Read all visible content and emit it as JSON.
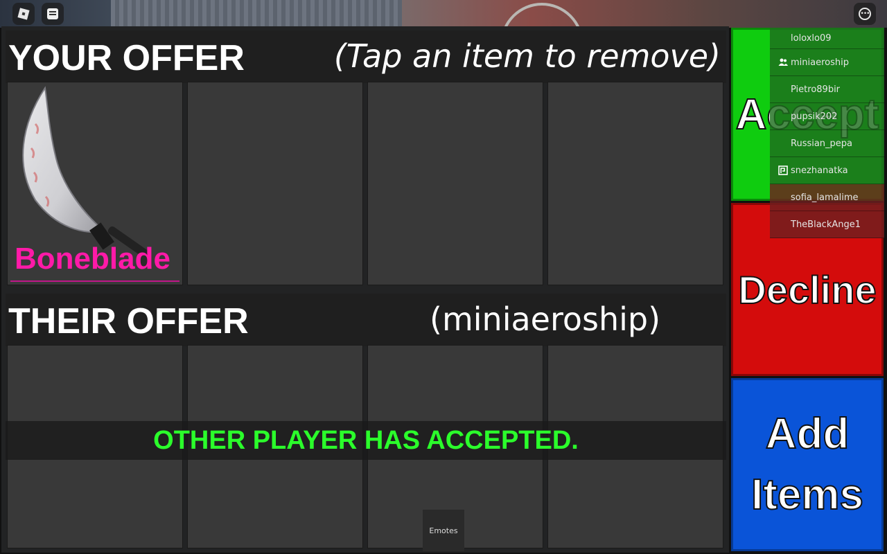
{
  "topbar": {
    "roblox_icon": "roblox-logo-icon",
    "chat_icon": "chat-icon",
    "more_icon": "more-options-icon"
  },
  "your_offer": {
    "title": "YOUR OFFER",
    "hint": "(Tap an item to remove)",
    "items": [
      {
        "name": "Boneblade",
        "color": "#ff1aa8"
      },
      {
        "name": ""
      },
      {
        "name": ""
      },
      {
        "name": ""
      }
    ]
  },
  "their_offer": {
    "title": "THEIR OFFER",
    "player": "(miniaeroship)"
  },
  "status_banner": "OTHER PLAYER HAS ACCEPTED.",
  "buttons": {
    "accept": "Accept",
    "decline": "Decline",
    "add_items_line1": "Add",
    "add_items_line2": "Items"
  },
  "emotes_label": "Emotes",
  "players": [
    {
      "name": "loloxlo09",
      "icon": "",
      "tint": "green"
    },
    {
      "name": "miniaeroship",
      "icon": "friends-icon",
      "tint": "green"
    },
    {
      "name": "Pietro89bir",
      "icon": "",
      "tint": "green"
    },
    {
      "name": "pupsik202",
      "icon": "",
      "tint": "green"
    },
    {
      "name": "Russian_pepa",
      "icon": "",
      "tint": "green"
    },
    {
      "name": "snezhanatka",
      "icon": "premium-icon",
      "tint": "green"
    },
    {
      "name": "sofia_lamalime",
      "icon": "",
      "tint": "red"
    },
    {
      "name": "TheBlackAnge1",
      "icon": "",
      "tint": "red"
    }
  ],
  "colors": {
    "accept": "#0fcc0f",
    "decline": "#d40c0c",
    "add_items": "#0a54d8",
    "banner_text": "#2bff2b"
  }
}
